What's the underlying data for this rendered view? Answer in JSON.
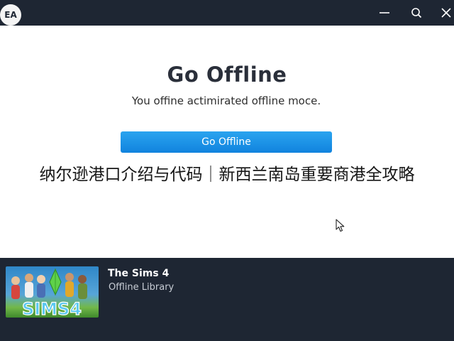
{
  "titlebar": {
    "logo_text": "EA",
    "icons": [
      "minimize-icon",
      "search-icon",
      "close-icon"
    ]
  },
  "dialog": {
    "heading": "Go Offline",
    "message": "You offine actimirated offline moce.",
    "button_label": "Go Offline"
  },
  "caption": "纳尔逊港口介绍与代码｜新西兰南岛重要商港全攻略",
  "library_item": {
    "title": "The Sims 4",
    "subtitle": "Offline Library",
    "cover_text": "SIMS4"
  },
  "colors": {
    "titlebar_bg": "#1e2633",
    "button_blue": "#1a90e6",
    "footer_bg": "#1e2633"
  }
}
